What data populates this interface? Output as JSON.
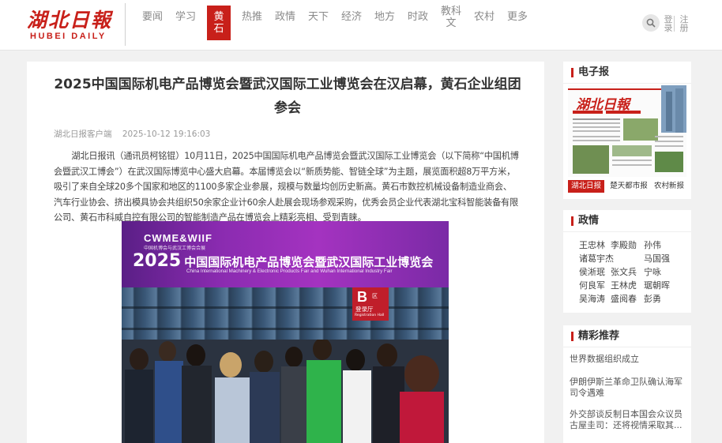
{
  "header": {
    "logo_cn": "湖北日報",
    "logo_en": "HUBEI DAILY",
    "nav": [
      "要闻",
      "学习",
      "黄石",
      "热推",
      "政情",
      "天下",
      "经济",
      "地方",
      "时政",
      "教科文",
      "农村",
      "更多"
    ],
    "active_nav": "黄石",
    "login": "登录",
    "register": "注册"
  },
  "article": {
    "title": "2025中国国际机电产品博览会暨武汉国际工业博览会在汉启幕，黄石企业组团参会",
    "source": "湖北日报客户端",
    "date": "2025-10-12 19:16:03",
    "body": "湖北日报讯（通讯员柯铭锟）10月11日，2025中国国际机电产品博览会暨武汉国际工业博览会（以下简称“中国机博会暨武汉工博会”）在武汉国际博览中心盛大启幕。本届博览会以“新质势能、智链全球”为主题，展览面积超8万平方米，吸引了来自全球20多个国家和地区的1100多家企业参展，规模与数量均创历史新高。黄石市数控机械设备制造业商会、汽车行业协会、挤出模具协会共组织50余家企业计60余人赴展会现场参观采购，优秀会员企业代表湖北宝科智能装备有限公司、黄石市科威自控有限公司的智能制造产品在博览会上精彩亮相、受到青睐。",
    "photo": {
      "brand": "CWME&WIIF",
      "brand_sub": "中国机博会与武汉工博会合展",
      "year": "2025",
      "title": "中国国际机电产品博览会暨武汉国际工业博览会",
      "title_en": "China International Machinery & Electronic Products Fair and Wuhan International Industry Fair",
      "sign_letter": "B",
      "sign_qu": "区",
      "sign_hall": "登录厅",
      "sign_en": "Registration Hall"
    }
  },
  "sidebar": {
    "epaper": {
      "heading": "电子报",
      "masthead": "湖北日報",
      "tabs": [
        "湖北日报",
        "楚天都市报",
        "农村新报"
      ]
    },
    "politics": {
      "heading": "政情",
      "names": [
        "王忠林",
        "李殿勋",
        "孙伟",
        "诸葛宇杰",
        "马国强",
        "侯淅珉",
        "张文兵",
        "宁咏",
        "何良军",
        "王林虎",
        "琚朝晖",
        "吴海涛",
        "盛阅春",
        "彭勇"
      ]
    },
    "recommend": {
      "heading": "精彩推荐",
      "items": [
        "世界数据组织成立",
        "伊朗伊斯兰革命卫队确认海军司令遇难",
        "外交部谈反制日本国会众议员古屋圭司：还将视情采取其..."
      ]
    }
  },
  "colors": {
    "brand_red": "#c8201a",
    "nav_text": "#8a8a8a",
    "page_bg": "#f1f1f1"
  },
  "icons": {
    "search": "search-icon"
  }
}
